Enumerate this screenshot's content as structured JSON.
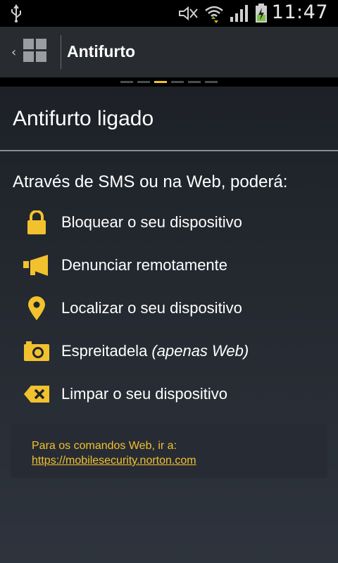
{
  "status_bar": {
    "time": "11:47",
    "icons": [
      "usb-icon",
      "mute-icon",
      "wifi-icon",
      "signal-icon",
      "battery-charging-icon"
    ]
  },
  "action_bar": {
    "title": "Antifurto"
  },
  "pager": {
    "count": 6,
    "active_index": 2
  },
  "content": {
    "heading": "Antifurto ligado",
    "intro": "Através de SMS ou na Web, poderá:",
    "features": [
      {
        "icon": "lock-icon",
        "label": "Bloquear o seu dispositivo",
        "suffix": ""
      },
      {
        "icon": "megaphone-icon",
        "label": "Denunciar remotamente",
        "suffix": ""
      },
      {
        "icon": "location-pin-icon",
        "label": "Localizar o seu dispositivo",
        "suffix": ""
      },
      {
        "icon": "camera-icon",
        "label": "Espreitadela ",
        "suffix": "(apenas Web)"
      },
      {
        "icon": "erase-icon",
        "label": "Limpar o seu dispositivo",
        "suffix": ""
      }
    ],
    "web_box": {
      "text": "Para os comandos Web, ir a:",
      "link": "https://mobilesecurity.norton.com"
    }
  },
  "colors": {
    "accent": "#f2c12e",
    "background": "#1d2128",
    "action_bar": "#282b2f"
  }
}
